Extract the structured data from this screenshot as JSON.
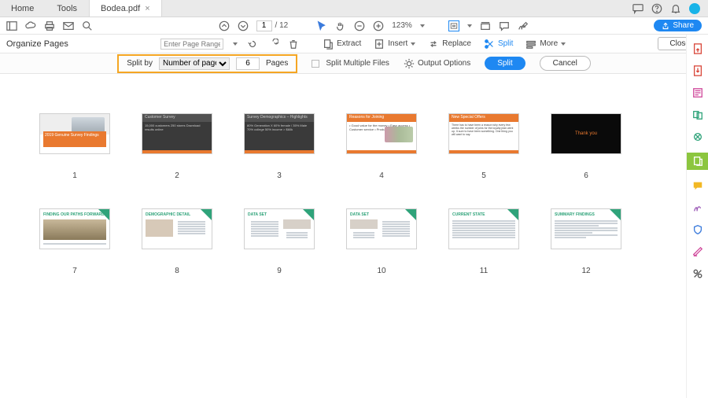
{
  "tabs": {
    "home": "Home",
    "tools": "Tools",
    "file": "Bodea.pdf"
  },
  "toolbar": {
    "page_current": "1",
    "page_total": "/ 12",
    "zoom": "123%",
    "share": "Share"
  },
  "orgbar": {
    "title": "Organize Pages",
    "range_placeholder": "Enter Page Range",
    "extract": "Extract",
    "insert": "Insert",
    "replace": "Replace",
    "split": "Split",
    "more": "More",
    "close": "Close"
  },
  "splitbar": {
    "splitby_label": "Split by",
    "splitby_option": "Number of pages",
    "count": "6",
    "pages_label": "Pages",
    "multi": "Split Multiple Files",
    "output": "Output Options",
    "split": "Split",
    "cancel": "Cancel"
  },
  "pages": [
    "1",
    "2",
    "3",
    "4",
    "5",
    "6",
    "7",
    "8",
    "9",
    "10",
    "11",
    "12"
  ],
  "thumb_text": {
    "t1": "2019 Genuine Survey Findings",
    "t2_title": "Customer Survey",
    "t2_body": "15,000 customers\n250 stores\nDownload results online",
    "t3_title": "Survey Demographics – Highlights",
    "t3_body": "80% Generation X\n60% female / 35% Male\n70% college\n50% income > $60k",
    "t4_title": "Reasons for Joining",
    "t4_body": "• Good value for the money\n• Easy access\n• Customer service\n• Products quality\n• Variety",
    "t5_title": "New Special Offers",
    "t5_body": "There has to have been a reason why every few\nweeks the number of joins for the loyalty plan went up.\nIt sure to have been something. One thing you will want\nto say.",
    "t6": "Thank you",
    "docA": "FINDING OUR PATHS FORWARD",
    "docB": "DEMOGRAPHIC DETAIL",
    "docC": "DATA SET",
    "docD": "DATA SET",
    "docE": "CURRENT STATE",
    "docF": "SUMMARY FINDINGS"
  }
}
